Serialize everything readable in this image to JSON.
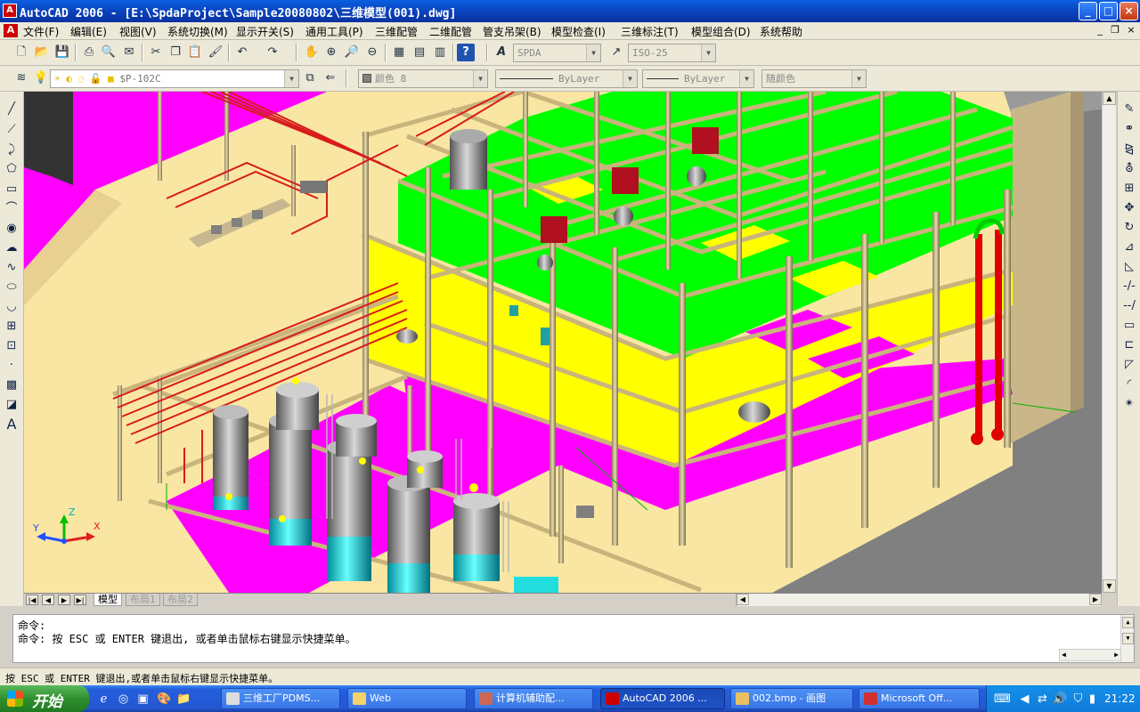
{
  "window": {
    "title": "AutoCAD 2006 - [E:\\SpdaProject\\Sample20080802\\三维模型(001).dwg]",
    "controls": {
      "minimize": "_",
      "maximize": "□",
      "close": "×"
    }
  },
  "menu": {
    "items": [
      "文件(F)",
      "编辑(E)",
      "视图(V)",
      "系统切换(M)",
      "显示开关(S)",
      "通用工具(P)",
      "三维配管",
      "二维配管",
      "管支吊架(B)",
      "模型检查(I)",
      "三维标注(T)",
      "模型组合(D)",
      "系统帮助"
    ],
    "mdi": {
      "minimize": "_",
      "restore": "❐",
      "close": "×"
    }
  },
  "toolbar": {
    "text_style": "SPDA",
    "dim_style": "ISO-25",
    "layer": "$P-102C",
    "color": "颜色 8",
    "linetype": "ByLayer",
    "lineweight": "ByLayer",
    "plot_style": "随颜色"
  },
  "tabs": {
    "items": [
      "模型",
      "布局1",
      "布局2"
    ]
  },
  "ucs": {
    "x": "X",
    "y": "Y",
    "z": "Z"
  },
  "command": {
    "line1": "命令:",
    "line2": "命令: 按 ESC 或 ENTER 键退出, 或者单击鼠标右键显示快捷菜单。"
  },
  "status": {
    "text": "按 ESC 或 ENTER 键退出,或者单击鼠标右键显示快捷菜单。"
  },
  "taskbar": {
    "start": "开始",
    "tasks": [
      "三维工厂PDMS...",
      "Web",
      "计算机辅助配...",
      "AutoCAD 2006 ...",
      "002.bmp - 画图",
      "Microsoft Off..."
    ],
    "clock": "21:22"
  }
}
